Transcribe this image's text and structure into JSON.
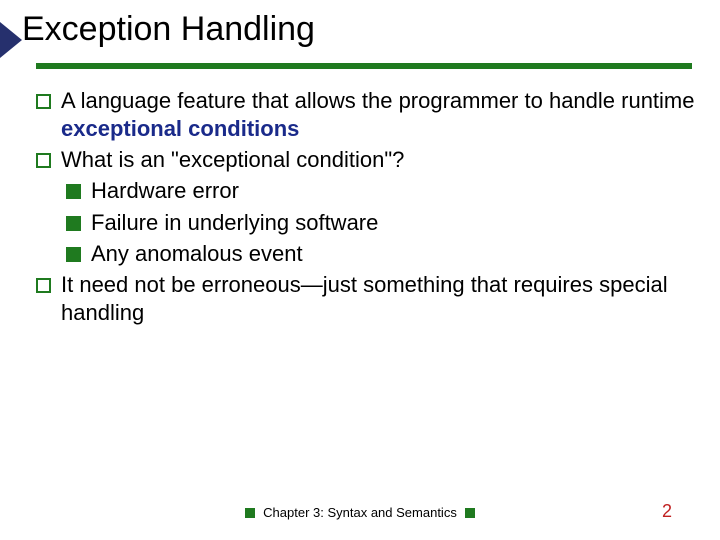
{
  "title": "Exception Handling",
  "bullets": {
    "b1_pre": "A language feature that allows the programmer to handle runtime ",
    "b1_bold": " exceptional conditions",
    "b2": "What is an \"exceptional condition\"?",
    "b2a": "Hardware error",
    "b2b": "Failure in underlying software",
    "b2c": "Any anomalous event",
    "b3": "It need not be erroneous—just something that requires special handling"
  },
  "footer": "Chapter 3: Syntax and Semantics",
  "page": "2"
}
